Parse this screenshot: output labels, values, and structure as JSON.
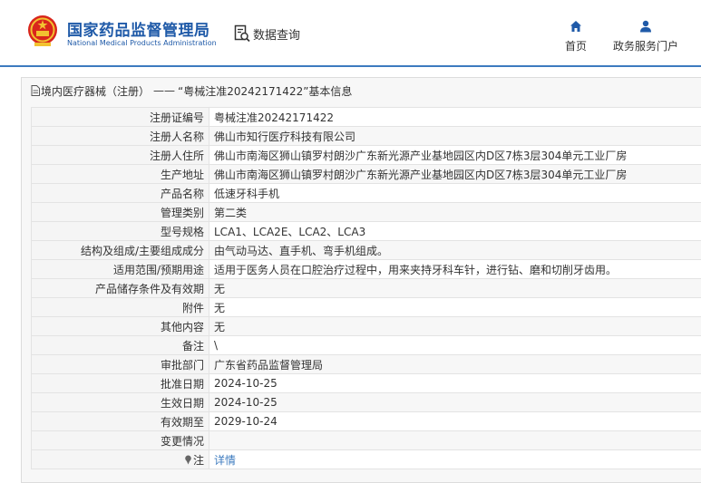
{
  "header": {
    "brand_cn": "国家药品监督管理局",
    "brand_en": "National Medical Products Administration",
    "search_label": "数据查询",
    "nav": [
      {
        "label": "首页",
        "icon": "home-icon"
      },
      {
        "label": "政务服务门户",
        "icon": "user-icon"
      }
    ],
    "accent_color": "#1f5aa8"
  },
  "breadcrumb": {
    "section": "境内医疗器械（注册）",
    "separator": "——",
    "current": "“粤械注准20242171422”基本信息"
  },
  "record": {
    "rows": [
      {
        "label": "注册证编号",
        "value": "粤械注准20242171422"
      },
      {
        "label": "注册人名称",
        "value": "佛山市知行医疗科技有限公司"
      },
      {
        "label": "注册人住所",
        "value": "佛山市南海区狮山镇罗村朗沙广东新光源产业基地园区内D区7栋3层304单元工业厂房"
      },
      {
        "label": "生产地址",
        "value": "佛山市南海区狮山镇罗村朗沙广东新光源产业基地园区内D区7栋3层304单元工业厂房"
      },
      {
        "label": "产品名称",
        "value": "低速牙科手机"
      },
      {
        "label": "管理类别",
        "value": "第二类"
      },
      {
        "label": "型号规格",
        "value": "LCA1、LCA2E、LCA2、LCA3"
      },
      {
        "label": "结构及组成/主要组成成分",
        "value": "由气动马达、直手机、弯手机组成。"
      },
      {
        "label": "适用范围/预期用途",
        "value": "适用于医务人员在口腔治疗过程中，用来夹持牙科车针，进行钻、磨和切削牙齿用。"
      },
      {
        "label": "产品储存条件及有效期",
        "value": "无"
      },
      {
        "label": "附件",
        "value": "无"
      },
      {
        "label": "其他内容",
        "value": "无"
      },
      {
        "label": "备注",
        "value": "\\"
      },
      {
        "label": "审批部门",
        "value": "广东省药品监督管理局"
      },
      {
        "label": "批准日期",
        "value": "2024-10-25"
      },
      {
        "label": "生效日期",
        "value": "2024-10-25"
      },
      {
        "label": "有效期至",
        "value": "2029-10-24"
      },
      {
        "label": "变更情况",
        "value": ""
      }
    ],
    "note": {
      "label": "注",
      "value": "详情",
      "icon": "pin-icon"
    }
  }
}
